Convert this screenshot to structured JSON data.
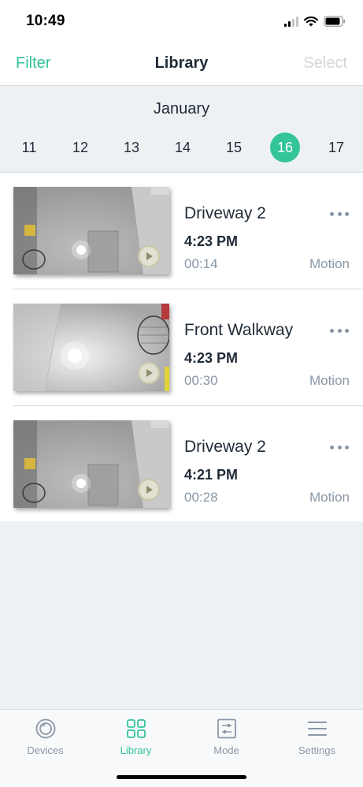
{
  "status_bar": {
    "time": "10:49"
  },
  "nav": {
    "filter_label": "Filter",
    "title": "Library",
    "select_label": "Select"
  },
  "date_strip": {
    "month": "January",
    "days": [
      "11",
      "12",
      "13",
      "14",
      "15",
      "16",
      "17"
    ],
    "selected_day": "16"
  },
  "clips": [
    {
      "camera": "Driveway 2",
      "time": "4:23 PM",
      "duration": "00:14",
      "event": "Motion"
    },
    {
      "camera": "Front Walkway",
      "time": "4:23 PM",
      "duration": "00:30",
      "event": "Motion"
    },
    {
      "camera": "Driveway 2",
      "time": "4:21 PM",
      "duration": "00:28",
      "event": "Motion"
    }
  ],
  "tabs": [
    {
      "label": "Devices",
      "icon": "devices-icon"
    },
    {
      "label": "Library",
      "icon": "library-icon",
      "active": true
    },
    {
      "label": "Mode",
      "icon": "mode-icon"
    },
    {
      "label": "Settings",
      "icon": "settings-icon"
    }
  ],
  "colors": {
    "accent": "#34c49a",
    "text": "#1f2a36",
    "muted": "#8a97a6",
    "background": "#eef1f4"
  }
}
